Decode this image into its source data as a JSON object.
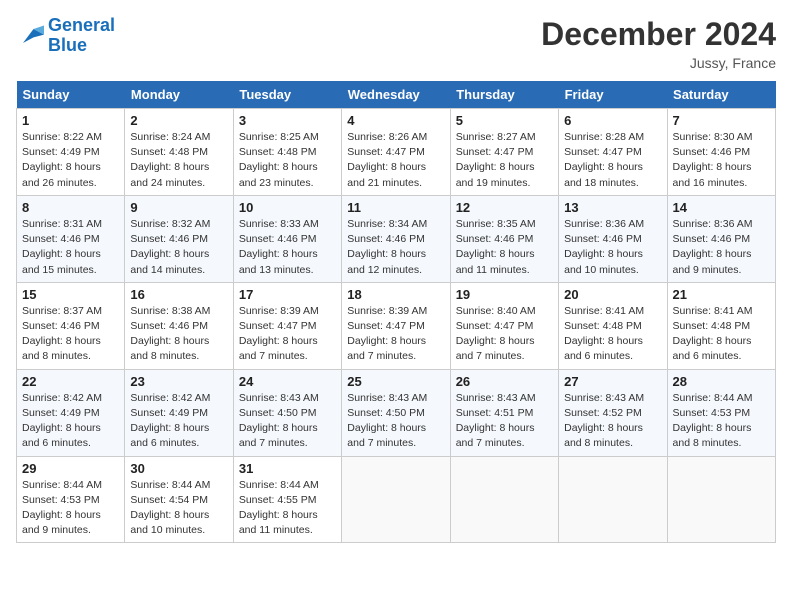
{
  "logo": {
    "line1": "General",
    "line2": "Blue"
  },
  "title": "December 2024",
  "location": "Jussy, France",
  "days_of_week": [
    "Sunday",
    "Monday",
    "Tuesday",
    "Wednesday",
    "Thursday",
    "Friday",
    "Saturday"
  ],
  "weeks": [
    [
      {
        "day": "1",
        "info": "Sunrise: 8:22 AM\nSunset: 4:49 PM\nDaylight: 8 hours\nand 26 minutes."
      },
      {
        "day": "2",
        "info": "Sunrise: 8:24 AM\nSunset: 4:48 PM\nDaylight: 8 hours\nand 24 minutes."
      },
      {
        "day": "3",
        "info": "Sunrise: 8:25 AM\nSunset: 4:48 PM\nDaylight: 8 hours\nand 23 minutes."
      },
      {
        "day": "4",
        "info": "Sunrise: 8:26 AM\nSunset: 4:47 PM\nDaylight: 8 hours\nand 21 minutes."
      },
      {
        "day": "5",
        "info": "Sunrise: 8:27 AM\nSunset: 4:47 PM\nDaylight: 8 hours\nand 19 minutes."
      },
      {
        "day": "6",
        "info": "Sunrise: 8:28 AM\nSunset: 4:47 PM\nDaylight: 8 hours\nand 18 minutes."
      },
      {
        "day": "7",
        "info": "Sunrise: 8:30 AM\nSunset: 4:46 PM\nDaylight: 8 hours\nand 16 minutes."
      }
    ],
    [
      {
        "day": "8",
        "info": "Sunrise: 8:31 AM\nSunset: 4:46 PM\nDaylight: 8 hours\nand 15 minutes."
      },
      {
        "day": "9",
        "info": "Sunrise: 8:32 AM\nSunset: 4:46 PM\nDaylight: 8 hours\nand 14 minutes."
      },
      {
        "day": "10",
        "info": "Sunrise: 8:33 AM\nSunset: 4:46 PM\nDaylight: 8 hours\nand 13 minutes."
      },
      {
        "day": "11",
        "info": "Sunrise: 8:34 AM\nSunset: 4:46 PM\nDaylight: 8 hours\nand 12 minutes."
      },
      {
        "day": "12",
        "info": "Sunrise: 8:35 AM\nSunset: 4:46 PM\nDaylight: 8 hours\nand 11 minutes."
      },
      {
        "day": "13",
        "info": "Sunrise: 8:36 AM\nSunset: 4:46 PM\nDaylight: 8 hours\nand 10 minutes."
      },
      {
        "day": "14",
        "info": "Sunrise: 8:36 AM\nSunset: 4:46 PM\nDaylight: 8 hours\nand 9 minutes."
      }
    ],
    [
      {
        "day": "15",
        "info": "Sunrise: 8:37 AM\nSunset: 4:46 PM\nDaylight: 8 hours\nand 8 minutes."
      },
      {
        "day": "16",
        "info": "Sunrise: 8:38 AM\nSunset: 4:46 PM\nDaylight: 8 hours\nand 8 minutes."
      },
      {
        "day": "17",
        "info": "Sunrise: 8:39 AM\nSunset: 4:47 PM\nDaylight: 8 hours\nand 7 minutes."
      },
      {
        "day": "18",
        "info": "Sunrise: 8:39 AM\nSunset: 4:47 PM\nDaylight: 8 hours\nand 7 minutes."
      },
      {
        "day": "19",
        "info": "Sunrise: 8:40 AM\nSunset: 4:47 PM\nDaylight: 8 hours\nand 7 minutes."
      },
      {
        "day": "20",
        "info": "Sunrise: 8:41 AM\nSunset: 4:48 PM\nDaylight: 8 hours\nand 6 minutes."
      },
      {
        "day": "21",
        "info": "Sunrise: 8:41 AM\nSunset: 4:48 PM\nDaylight: 8 hours\nand 6 minutes."
      }
    ],
    [
      {
        "day": "22",
        "info": "Sunrise: 8:42 AM\nSunset: 4:49 PM\nDaylight: 8 hours\nand 6 minutes."
      },
      {
        "day": "23",
        "info": "Sunrise: 8:42 AM\nSunset: 4:49 PM\nDaylight: 8 hours\nand 6 minutes."
      },
      {
        "day": "24",
        "info": "Sunrise: 8:43 AM\nSunset: 4:50 PM\nDaylight: 8 hours\nand 7 minutes."
      },
      {
        "day": "25",
        "info": "Sunrise: 8:43 AM\nSunset: 4:50 PM\nDaylight: 8 hours\nand 7 minutes."
      },
      {
        "day": "26",
        "info": "Sunrise: 8:43 AM\nSunset: 4:51 PM\nDaylight: 8 hours\nand 7 minutes."
      },
      {
        "day": "27",
        "info": "Sunrise: 8:43 AM\nSunset: 4:52 PM\nDaylight: 8 hours\nand 8 minutes."
      },
      {
        "day": "28",
        "info": "Sunrise: 8:44 AM\nSunset: 4:53 PM\nDaylight: 8 hours\nand 8 minutes."
      }
    ],
    [
      {
        "day": "29",
        "info": "Sunrise: 8:44 AM\nSunset: 4:53 PM\nDaylight: 8 hours\nand 9 minutes."
      },
      {
        "day": "30",
        "info": "Sunrise: 8:44 AM\nSunset: 4:54 PM\nDaylight: 8 hours\nand 10 minutes."
      },
      {
        "day": "31",
        "info": "Sunrise: 8:44 AM\nSunset: 4:55 PM\nDaylight: 8 hours\nand 11 minutes."
      },
      {
        "day": "",
        "info": ""
      },
      {
        "day": "",
        "info": ""
      },
      {
        "day": "",
        "info": ""
      },
      {
        "day": "",
        "info": ""
      }
    ]
  ]
}
